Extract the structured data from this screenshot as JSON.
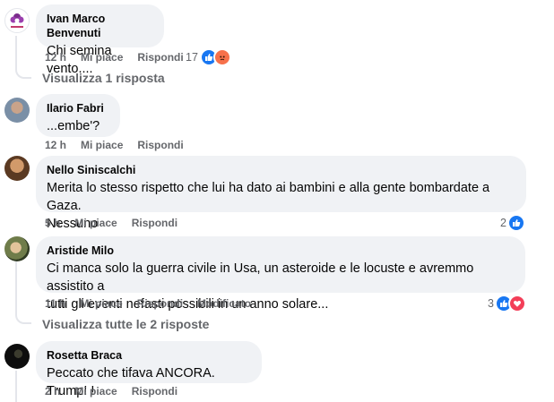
{
  "comments": [
    {
      "author": "Ivan Marco Benvenuti",
      "text": "Chi semina vento....",
      "time": "12 h",
      "like": "Mi piace",
      "reply": "Rispondi",
      "reactions": "17"
    },
    {
      "author": "Ilario Fabri",
      "text": "...embe'?",
      "time": "12 h",
      "like": "Mi piace",
      "reply": "Rispondi"
    },
    {
      "author": "Nello Siniscalchi",
      "text_line1": "Merita lo stesso rispetto che lui ha dato ai bambini e alla gente bombardate a Gaza.",
      "text_line2": "Nessuno",
      "time": "5 h",
      "like": "Mi piace",
      "reply": "Rispondi",
      "reactions": "2"
    },
    {
      "author": "Aristide Milo",
      "text_line1": "Ci manca solo la guerra civile in Usa, un asteroide e le locuste e avremmo assistito a",
      "text_line2": "tutti gli eventi nefasti possibili in un anno solare...",
      "time": "11 h",
      "like": "Mi piace",
      "reply": "Rispondi",
      "edited": "Modificato",
      "reactions": "3"
    },
    {
      "author": "Rosetta Braca",
      "text": "Peccato che tifava ANCORA. Trump! !",
      "time": "2 h",
      "like": "Mi piace",
      "reply": "Rispondi"
    }
  ],
  "view_replies_1": "Visualizza 1 risposta",
  "view_replies_2": "Visualizza tutte le 2 risposte",
  "icons": {
    "like": "thumbs-up-icon",
    "angry": "angry-face-icon",
    "love": "heart-icon"
  },
  "colors": {
    "like": "#1877f2",
    "angry": "#f7714b",
    "love": "#f33e58",
    "bubble": "#f0f2f5",
    "meta": "#65676b"
  }
}
